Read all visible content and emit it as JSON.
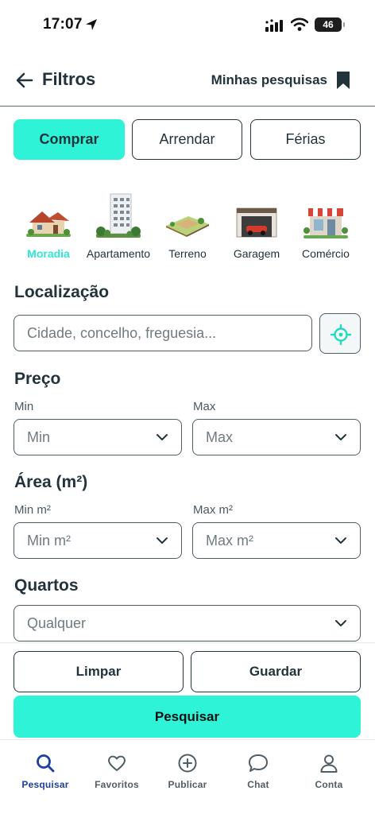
{
  "status_bar": {
    "time": "17:07",
    "battery": "46"
  },
  "header": {
    "title": "Filtros",
    "saved_searches": "Minhas pesquisas"
  },
  "tabs": [
    {
      "label": "Comprar",
      "active": true
    },
    {
      "label": "Arrendar",
      "active": false
    },
    {
      "label": "Férias",
      "active": false
    }
  ],
  "property_types": [
    {
      "label": "Moradia",
      "icon": "house-icon",
      "active": true
    },
    {
      "label": "Apartamento",
      "icon": "apartment-building-icon",
      "active": false
    },
    {
      "label": "Terreno",
      "icon": "land-plot-icon",
      "active": false
    },
    {
      "label": "Garagem",
      "icon": "garage-icon",
      "active": false
    },
    {
      "label": "Comércio",
      "icon": "shop-icon",
      "active": false
    }
  ],
  "location": {
    "title": "Localização",
    "placeholder": "Cidade, concelho, freguesia...",
    "gps_icon": "crosshair-icon"
  },
  "price": {
    "title": "Preço",
    "min_label": "Min",
    "min_value": "Min",
    "max_label": "Max",
    "max_value": "Max"
  },
  "area": {
    "title": "Área (m²)",
    "min_label": "Min m²",
    "min_value": "Min m²",
    "max_label": "Max m²",
    "max_value": "Max m²"
  },
  "rooms": {
    "title": "Quartos",
    "value": "Qualquer"
  },
  "actions": {
    "clear": "Limpar",
    "save": "Guardar",
    "search": "Pesquisar"
  },
  "nav": [
    {
      "label": "Pesquisar",
      "icon": "search-icon",
      "active": true
    },
    {
      "label": "Favoritos",
      "icon": "heart-icon",
      "active": false
    },
    {
      "label": "Publicar",
      "icon": "plus-circle-icon",
      "active": false
    },
    {
      "label": "Chat",
      "icon": "chat-bubble-icon",
      "active": false
    },
    {
      "label": "Conta",
      "icon": "user-icon",
      "active": false
    }
  ],
  "colors": {
    "accent": "#2ef3d7",
    "text": "#23333b",
    "nav_active": "#1f3fa0"
  }
}
